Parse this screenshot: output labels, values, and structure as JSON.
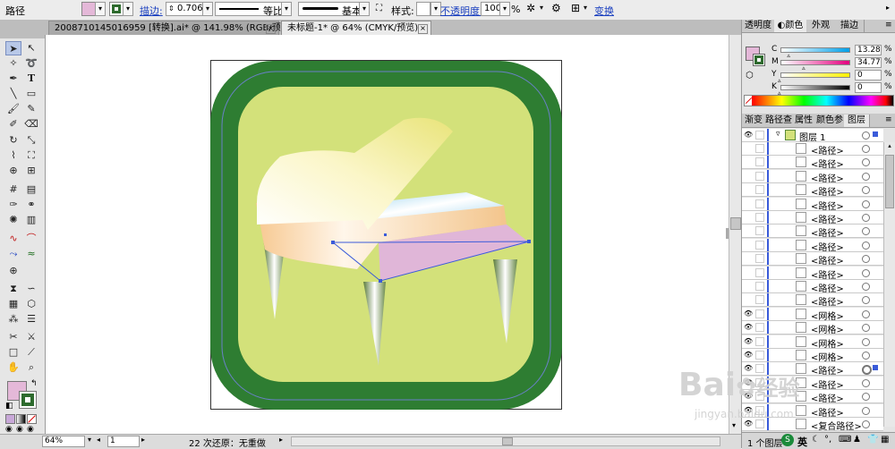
{
  "control_bar": {
    "tool_name": "路径",
    "fill_color": "#e4b8d8",
    "stroke_color": "#2e6b2e",
    "stroke_label": "描边:",
    "stroke_width": "0.706",
    "profile_label": "等比",
    "brush_label": "基本",
    "style_label": "样式:",
    "opacity_label": "不透明度:",
    "opacity_value": "100",
    "opacity_unit": "%",
    "transform_label": "变换"
  },
  "doc_tabs": [
    {
      "label": "2008710145016959 [转换].ai* @ 141.98% (RGB/预览)",
      "active": false
    },
    {
      "label": "未标题-1* @ 64% (CMYK/预览)",
      "active": true
    }
  ],
  "tools": {
    "fill_swatch": "#e4b8d8",
    "stroke_swatch": "#2e6b2e"
  },
  "status_bar": {
    "zoom": "64%",
    "page": "1",
    "undo_text": "22 次还原：无重做"
  },
  "color_panel": {
    "tabs": [
      "透明度",
      "颜色",
      "外观",
      "描边"
    ],
    "active_tab": "颜色",
    "fill_color": "#e4b8d8",
    "stroke_color": "#2e6b2e",
    "channels": [
      {
        "label": "C",
        "value": "13.28",
        "percent": 13.28,
        "gradient": "linear-gradient(90deg,#ffffff,#00a0e9)"
      },
      {
        "label": "M",
        "value": "34.77",
        "percent": 34.77,
        "gradient": "linear-gradient(90deg,#ffffff,#e4007f)"
      },
      {
        "label": "Y",
        "value": "0",
        "percent": 0,
        "gradient": "linear-gradient(90deg,#ffffff,#fff100)"
      },
      {
        "label": "K",
        "value": "0",
        "percent": 0,
        "gradient": "linear-gradient(90deg,#ffffff,#000000)"
      }
    ],
    "percent_sign": "%"
  },
  "layers_panel": {
    "tabs": [
      "渐变",
      "路径查",
      "属性",
      "颜色参",
      "图层"
    ],
    "active_tab": "图层",
    "layer_name": "图层 1",
    "rows": [
      {
        "name": "<路径>",
        "eye": false
      },
      {
        "name": "<路径>",
        "eye": false
      },
      {
        "name": "<路径>",
        "eye": false
      },
      {
        "name": "<路径>",
        "eye": false
      },
      {
        "name": "<路径>",
        "eye": false
      },
      {
        "name": "<路径>",
        "eye": false
      },
      {
        "name": "<路径>",
        "eye": false
      },
      {
        "name": "<路径>",
        "eye": false
      },
      {
        "name": "<路径>",
        "eye": false
      },
      {
        "name": "<路径>",
        "eye": false
      },
      {
        "name": "<路径>",
        "eye": false
      },
      {
        "name": "<路径>",
        "eye": false
      },
      {
        "name": "<网格>",
        "eye": true
      },
      {
        "name": "<网格>",
        "eye": true
      },
      {
        "name": "<网格>",
        "eye": true
      },
      {
        "name": "<网格>",
        "eye": true
      },
      {
        "name": "<路径>",
        "eye": true,
        "selected": true
      },
      {
        "name": "<路径>",
        "eye": true
      },
      {
        "name": "<路径>",
        "eye": true
      },
      {
        "name": "<路径>",
        "eye": true
      },
      {
        "name": "<复合路径>",
        "eye": true
      }
    ],
    "footer": "1 个图层"
  },
  "watermark": {
    "brand": "Bai",
    "brand2": "经验",
    "url": "jingyan.baidu.com"
  },
  "ime": {
    "label": "英"
  }
}
